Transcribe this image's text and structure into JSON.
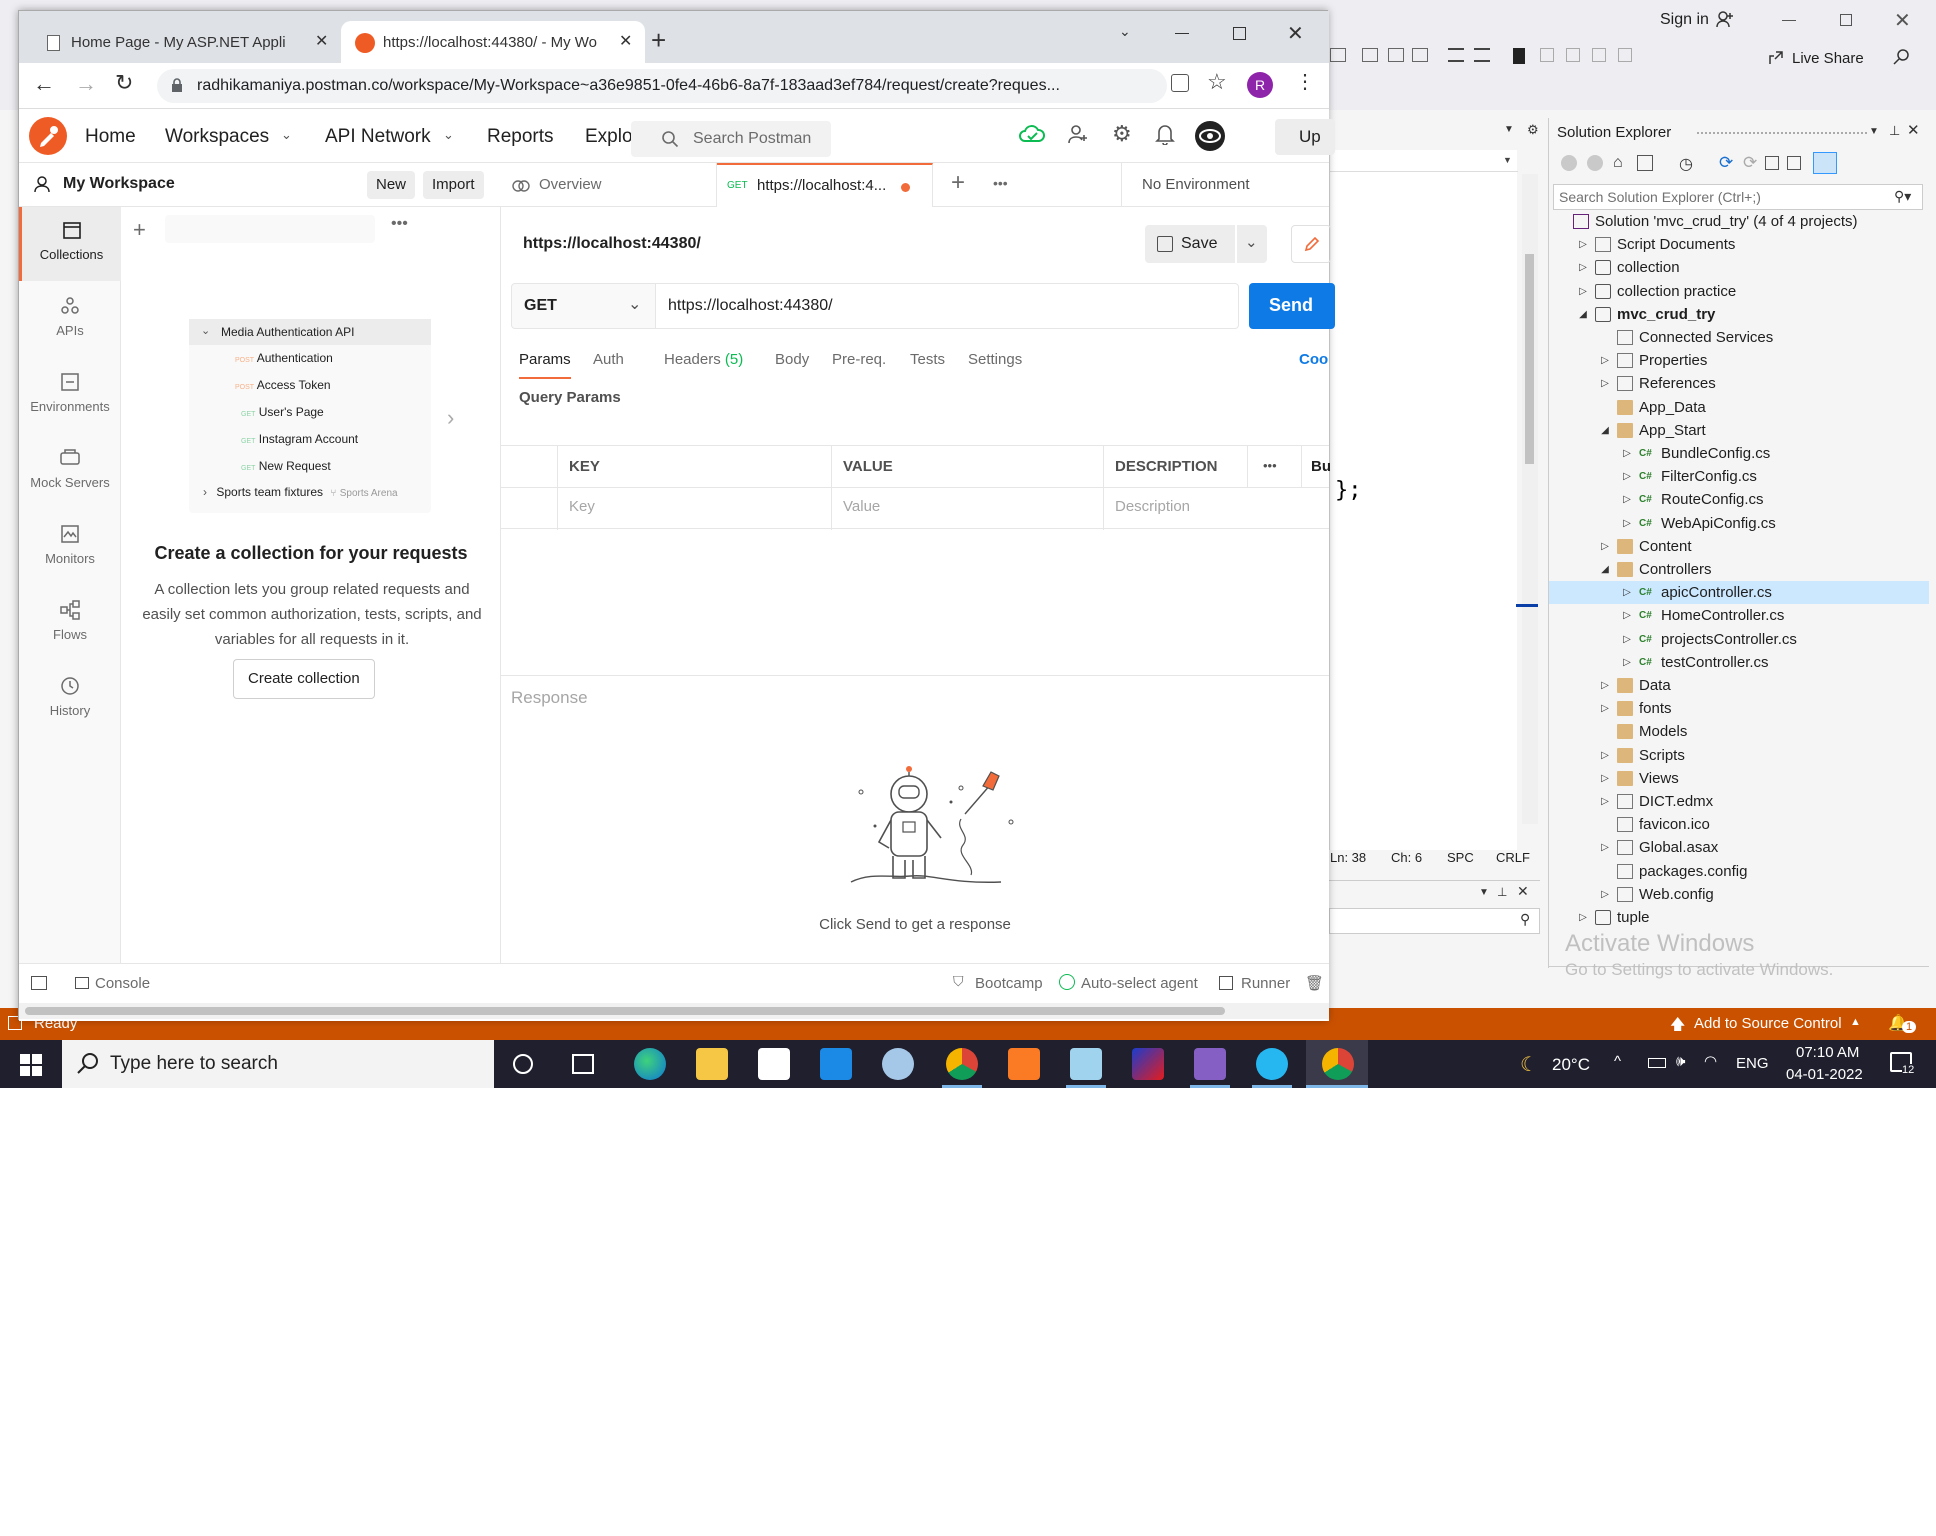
{
  "vs": {
    "sign_in": "Sign in",
    "live_share": "Live Share",
    "editor_code": "};",
    "status_ln": "Ln: 38",
    "status_ch": "Ch: 6",
    "status_spc": "SPC",
    "status_crlf": "CRLF",
    "status_ready": "Ready",
    "add_source_control": "Add to Source Control",
    "notification_count": "1",
    "solution_explorer": {
      "title": "Solution Explorer",
      "search_placeholder": "Search Solution Explorer (Ctrl+;)",
      "items": [
        {
          "label": "Solution 'mvc_crud_try' (4 of 4 projects)",
          "icon": "solution-icon"
        },
        {
          "label": "Script Documents",
          "icon": "script-docs-icon"
        },
        {
          "label": "collection",
          "icon": "web-project-icon"
        },
        {
          "label": "collection practice",
          "icon": "web-project-icon"
        },
        {
          "label": "mvc_crud_try",
          "icon": "web-project-icon"
        },
        {
          "label": "Connected Services",
          "icon": "connected-services-icon"
        },
        {
          "label": "Properties",
          "icon": "wrench-icon"
        },
        {
          "label": "References",
          "icon": "references-icon"
        },
        {
          "label": "App_Data",
          "icon": "folder-icon"
        },
        {
          "label": "App_Start",
          "icon": "folder-open-icon"
        },
        {
          "label": "BundleConfig.cs",
          "icon": "csharp-file-icon"
        },
        {
          "label": "FilterConfig.cs",
          "icon": "csharp-file-icon"
        },
        {
          "label": "RouteConfig.cs",
          "icon": "csharp-file-icon"
        },
        {
          "label": "WebApiConfig.cs",
          "icon": "csharp-file-icon"
        },
        {
          "label": "Content",
          "icon": "folder-icon"
        },
        {
          "label": "Controllers",
          "icon": "folder-open-icon"
        },
        {
          "label": "apicController.cs",
          "icon": "csharp-file-icon"
        },
        {
          "label": "HomeController.cs",
          "icon": "csharp-file-icon"
        },
        {
          "label": "projectsController.cs",
          "icon": "csharp-file-icon"
        },
        {
          "label": "testController.cs",
          "icon": "csharp-file-icon"
        },
        {
          "label": "Data",
          "icon": "folder-icon"
        },
        {
          "label": "fonts",
          "icon": "folder-icon"
        },
        {
          "label": "Models",
          "icon": "folder-icon"
        },
        {
          "label": "Scripts",
          "icon": "folder-icon"
        },
        {
          "label": "Views",
          "icon": "folder-icon"
        },
        {
          "label": "DICT.edmx",
          "icon": "edmx-icon"
        },
        {
          "label": "favicon.ico",
          "icon": "file-icon"
        },
        {
          "label": "Global.asax",
          "icon": "config-icon"
        },
        {
          "label": "packages.config",
          "icon": "config-icon"
        },
        {
          "label": "Web.config",
          "icon": "config-icon"
        },
        {
          "label": "tuple",
          "icon": "cs-project-icon"
        }
      ]
    },
    "activate_windows": {
      "line1": "Activate Windows",
      "line2": "Go to Settings to activate Windows."
    }
  },
  "chrome": {
    "tabs": [
      {
        "title": "Home Page - My ASP.NET Applic",
        "favicon": "page-icon"
      },
      {
        "title": "https://localhost:44380/ - My Wo",
        "favicon": "postman-icon"
      }
    ],
    "url": "radhikamaniya.postman.co/workspace/My-Workspace~a36e9851-0fe4-46b6-8a7f-183aad3ef784/request/create?reques...",
    "profile_initial": "R"
  },
  "postman": {
    "nav": {
      "home": "Home",
      "workspaces": "Workspaces",
      "api_network": "API Network",
      "reports": "Reports",
      "explore": "Explo",
      "search_placeholder": "Search Postman",
      "upgrade": "Up"
    },
    "workspace_name": "My Workspace",
    "new_label": "New",
    "import_label": "Import",
    "sidebar": [
      {
        "label": "Collections",
        "icon": "collections-icon"
      },
      {
        "label": "APIs",
        "icon": "apis-icon"
      },
      {
        "label": "Environments",
        "icon": "environments-icon"
      },
      {
        "label": "Mock Servers",
        "icon": "mock-servers-icon"
      },
      {
        "label": "Monitors",
        "icon": "monitors-icon"
      },
      {
        "label": "Flows",
        "icon": "flows-icon"
      },
      {
        "label": "History",
        "icon": "history-icon"
      }
    ],
    "preview": {
      "collection": "Media Authentication API",
      "requests": [
        {
          "method": "POST",
          "name": "Authentication"
        },
        {
          "method": "POST",
          "name": "Access Token"
        },
        {
          "method": "GET",
          "name": "User's Page"
        },
        {
          "method": "GET",
          "name": "Instagram Account"
        },
        {
          "method": "GET",
          "name": "New Request"
        }
      ],
      "second_collection": "Sports team fixtures",
      "second_collection_fork": "Sports Arena"
    },
    "empty_title": "Create a collection for your requests",
    "empty_desc": "A collection lets you group related requests and easily set common authorization, tests, scripts, and variables for all requests in it.",
    "create_collection": "Create collection",
    "tabs": {
      "overview": "Overview",
      "active_method": "GET",
      "active_title": "https://localhost:4...",
      "environment": "No Environment"
    },
    "request_name": "https://localhost:44380/",
    "save_label": "Save",
    "method": "GET",
    "url": "https://localhost:44380/",
    "send_label": "Send",
    "req_tabs": [
      "Params",
      "Auth",
      "Headers",
      "Body",
      "Pre-req.",
      "Tests",
      "Settings"
    ],
    "headers_count": "(5)",
    "cookies_label": "Coo",
    "query_params_title": "Query Params",
    "table_headers": [
      "KEY",
      "VALUE",
      "DESCRIPTION",
      "Bu"
    ],
    "table_placeholders": [
      "Key",
      "Value",
      "Description"
    ],
    "response_label": "Response",
    "response_hint": "Click Send to get a response",
    "footer": {
      "console": "Console",
      "bootcamp": "Bootcamp",
      "agent": "Auto-select agent",
      "runner": "Runner"
    }
  },
  "taskbar": {
    "search_placeholder": "Type here to search",
    "weather": "20°C",
    "lang": "ENG",
    "time": "07:10 AM",
    "date": "04-01-2022",
    "notifications": "12"
  }
}
